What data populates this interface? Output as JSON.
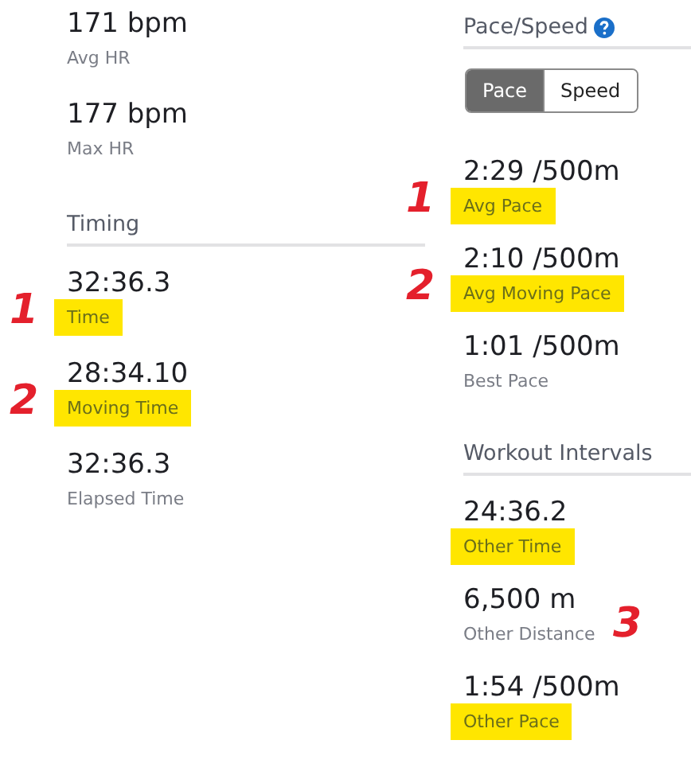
{
  "columns": [
    {
      "sections": [
        {
          "stats": [
            {
              "value": "171 bpm",
              "label": "Avg HR",
              "highlighted": false
            },
            {
              "value": "177 bpm",
              "label": "Max HR",
              "highlighted": false
            }
          ]
        },
        {
          "title": "Timing",
          "stats": [
            {
              "value": "32:36.3",
              "label": "Time",
              "highlighted": true,
              "marker": "1"
            },
            {
              "value": "28:34.10",
              "label": "Moving Time",
              "highlighted": true,
              "marker": "2"
            },
            {
              "value": "32:36.3",
              "label": "Elapsed Time",
              "highlighted": false
            }
          ]
        }
      ]
    },
    {
      "sections": [
        {
          "title": "Pace/Speed",
          "help": true,
          "toggle": [
            {
              "label": "Pace",
              "selected": true
            },
            {
              "label": "Speed",
              "selected": false
            }
          ],
          "stats": [
            {
              "value": "2:29 /500m",
              "label": "Avg Pace",
              "highlighted": true,
              "marker": "1"
            },
            {
              "value": "2:10 /500m",
              "label": "Avg Moving Pace",
              "highlighted": true,
              "marker": "2"
            },
            {
              "value": "1:01 /500m",
              "label": "Best Pace",
              "highlighted": false
            }
          ]
        },
        {
          "title": "Workout Intervals",
          "annotation": "3",
          "stats": [
            {
              "value": "24:36.2",
              "label": "Other Time",
              "highlighted": true
            },
            {
              "value": "6,500 m",
              "label": "Other Distance",
              "highlighted": false
            },
            {
              "value": "1:54 /500m",
              "label": "Other Pace",
              "highlighted": true
            }
          ]
        }
      ]
    }
  ]
}
